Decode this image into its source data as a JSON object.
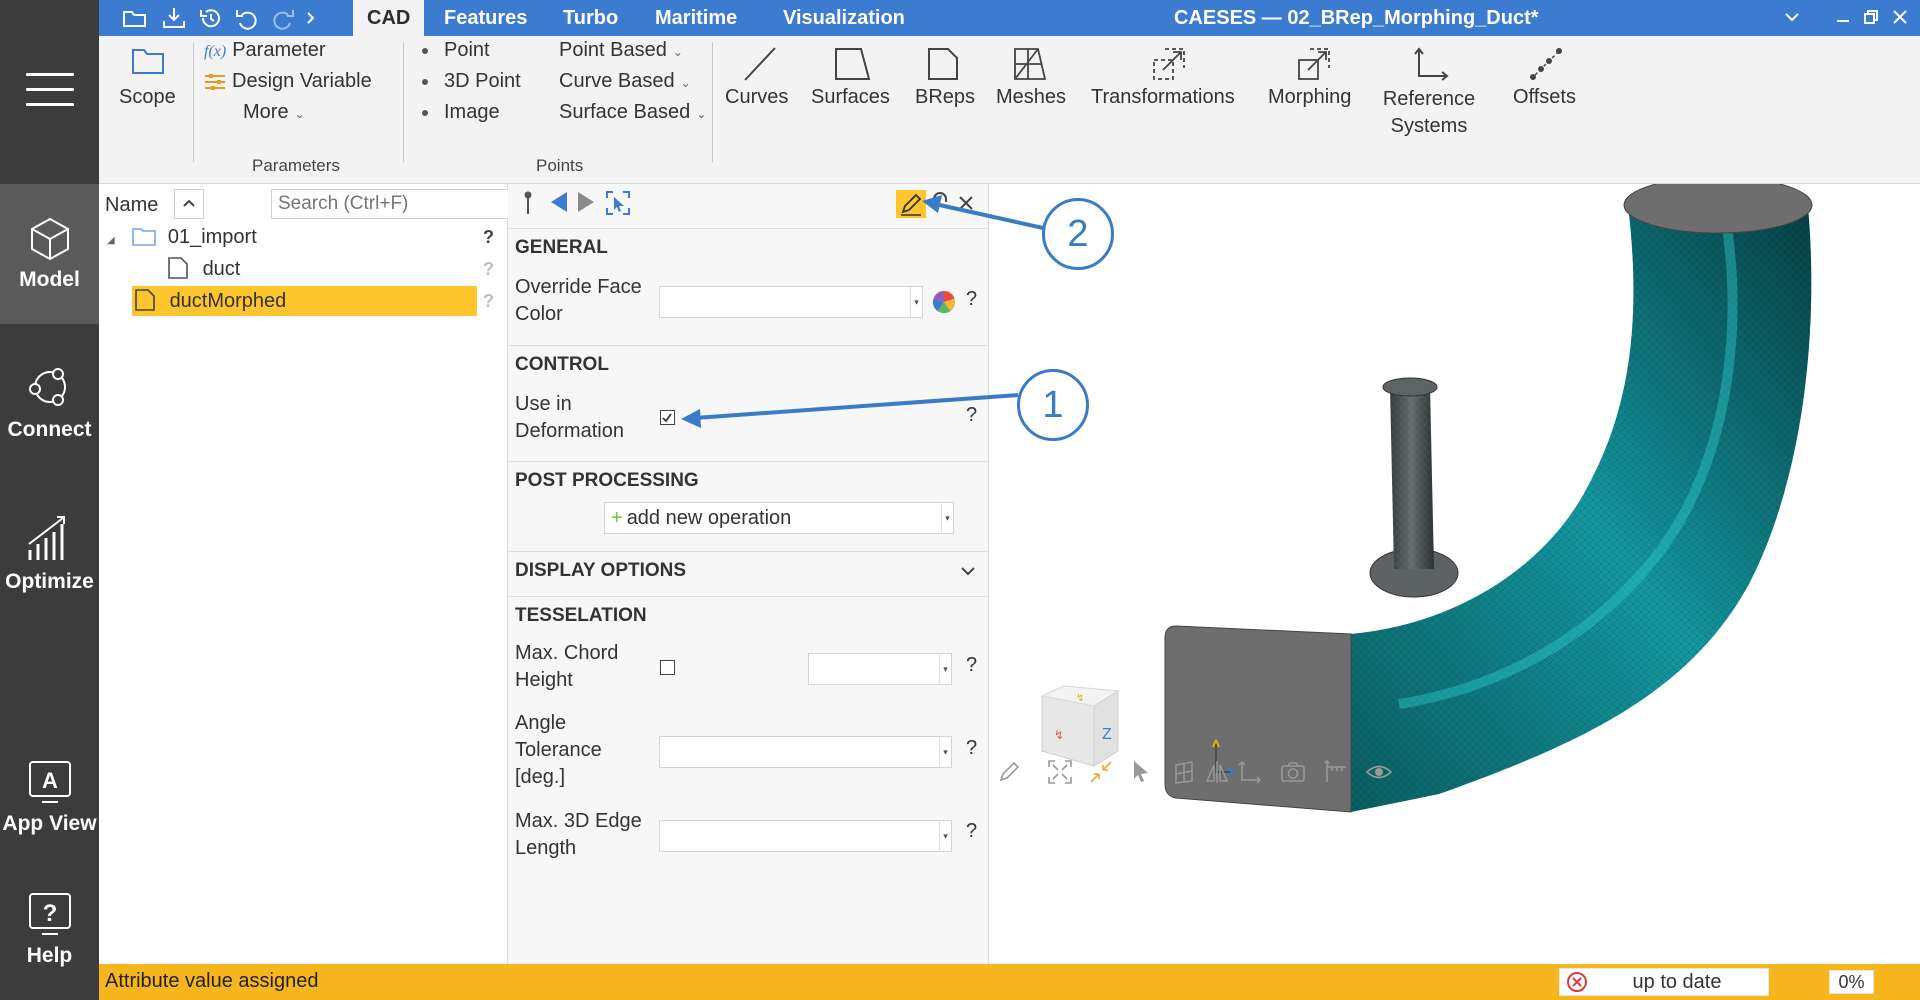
{
  "window": {
    "title": "CAESES — 02_BRep_Morphing_Duct*"
  },
  "tabs": [
    {
      "label": "CAD",
      "active": true
    },
    {
      "label": "Features"
    },
    {
      "label": "Turbo"
    },
    {
      "label": "Maritime"
    },
    {
      "label": "Visualization"
    }
  ],
  "rail": {
    "model": "Model",
    "connect": "Connect",
    "optimize": "Optimize",
    "app_view": "App View",
    "help": "Help"
  },
  "ribbon": {
    "scope": "Scope",
    "parameter": "Parameter",
    "design_variable": "Design Variable",
    "more": "More",
    "group_parameters": "Parameters",
    "point": "Point",
    "point_3d": "3D Point",
    "image": "Image",
    "point_based": "Point Based",
    "curve_based": "Curve Based",
    "surface_based": "Surface Based",
    "group_points": "Points",
    "curves": "Curves",
    "surfaces": "Surfaces",
    "breps": "BReps",
    "meshes": "Meshes",
    "transformations": "Transformations",
    "morphing": "Morphing",
    "reference_line1": "Reference",
    "reference_line2": "Systems",
    "offsets": "Offsets"
  },
  "tree": {
    "name_header": "Name",
    "search_placeholder": "Search (Ctrl+F)",
    "items": [
      {
        "label": "01_import"
      },
      {
        "label": "duct"
      },
      {
        "label": "ductMorphed",
        "selected": true
      }
    ]
  },
  "props": {
    "general": "GENERAL",
    "override_line1": "Override Face",
    "override_line2": "Color",
    "control": "CONTROL",
    "use_line1": "Use in",
    "use_line2": "Deformation",
    "use_in_deformation_checked": true,
    "post": "POST PROCESSING",
    "add_op": "add new operation",
    "display": "DISPLAY OPTIONS",
    "tesselation": "TESSELATION",
    "chord_line1": "Max. Chord",
    "chord_line2": "Height",
    "angle_line1": "Angle",
    "angle_line2": "Tolerance",
    "angle_line3": "[deg.]",
    "edge_line1": "Max. 3D Edge",
    "edge_line2": "Length",
    "help": "?"
  },
  "callouts": {
    "one": "1",
    "two": "2"
  },
  "status": {
    "message": "Attribute value assigned",
    "state": "up to date",
    "progress": "0%"
  },
  "colors": {
    "titlebar": "#3b7bd0",
    "rail": "#3c3c3c",
    "selection": "#ffc52e",
    "status": "#f7b51e",
    "duct": "#0a5c5e",
    "callout": "#3a7bc8"
  }
}
